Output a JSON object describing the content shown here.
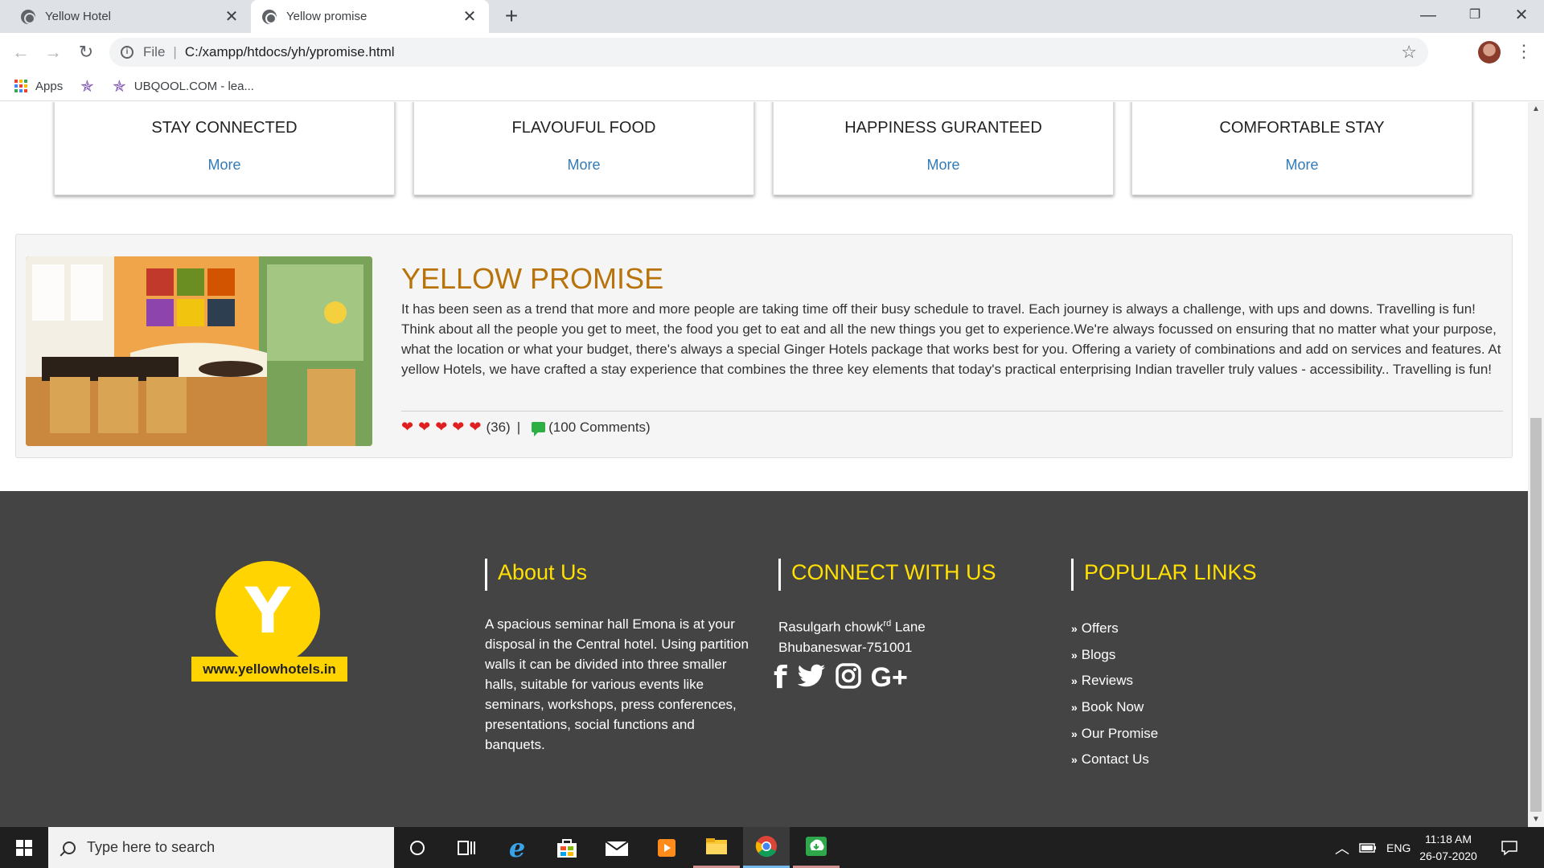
{
  "browser": {
    "tabs": [
      {
        "title": "Yellow Hotel",
        "active": false
      },
      {
        "title": "Yellow promise",
        "active": true
      }
    ],
    "address": {
      "scheme": "File",
      "url": "C:/xampp/htdocs/yh/ypromise.html"
    },
    "bookmarks": [
      {
        "label": "Apps"
      },
      {
        "label": ""
      },
      {
        "label": "UBQOOL.COM - lea..."
      }
    ]
  },
  "features": [
    {
      "title": "STAY CONNECTED",
      "link": "More"
    },
    {
      "title": "FLAVOUFUL FOOD",
      "link": "More"
    },
    {
      "title": "HAPPINESS GURANTEED",
      "link": "More"
    },
    {
      "title": "COMFORTABLE STAY",
      "link": "More"
    }
  ],
  "promise": {
    "title": "YELLOW PROMISE",
    "body": "It has been seen as a trend that more and more people are taking time off their busy schedule to travel. Each journey is always a challenge, with ups and downs. Travelling is fun! Think about all the people you get to meet, the food you get to eat and all the new things you get to experience.We're always focussed on ensuring that no matter what your purpose, what the location or what your budget, there's always a special Ginger Hotels package that works best for you. Offering a variety of combinations and add on services and features. At yellow Hotels, we have crafted a stay experience that combines the three key elements that today's practical enterprising Indian traveller truly values - accessibility.. Travelling is fun!",
    "rating": 5,
    "rating_count": "(36)",
    "separator": "|",
    "comments": "(100 Comments)",
    "colors": {
      "title": "#b8730a",
      "heart": "#e02020",
      "comment": "#2eae43"
    }
  },
  "footer": {
    "logo_letter": "Y",
    "logo_url": "www.yellowhotels.in",
    "about": {
      "heading": "About Us",
      "text": "A spacious seminar hall Emona is at your disposal in the Central hotel. Using partition walls it can be divided into three smaller halls, suitable for various events like seminars, workshops, press conferences, presentations, social functions and banquets."
    },
    "connect": {
      "heading": "CONNECT WITH US",
      "address_line1_pre": "Rasulgarh chowk",
      "address_line1_sup": "rd",
      "address_line1_post": " Lane",
      "address_line2": "Bhubaneswar-751001",
      "social": [
        "facebook-icon",
        "twitter-icon",
        "instagram-icon",
        "google-plus-icon"
      ]
    },
    "links": {
      "heading": "POPULAR LINKS",
      "items": [
        "Offers",
        "Blogs",
        "Reviews",
        "Book Now",
        "Our Promise",
        "Contact Us"
      ]
    },
    "colors": {
      "background": "#444444",
      "heading": "#ffe000",
      "logo": "#ffd400"
    }
  },
  "taskbar": {
    "search_placeholder": "Type here to search",
    "language": "ENG",
    "time": "11:18 AM",
    "date": "26-07-2020"
  }
}
